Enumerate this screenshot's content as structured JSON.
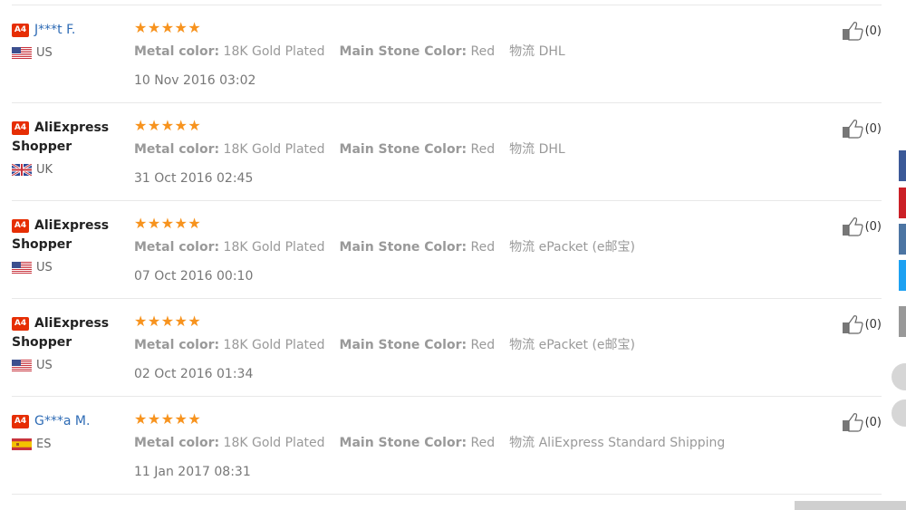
{
  "reviews": [
    {
      "name": "J***t F.",
      "masked": true,
      "badge": "A4",
      "country": "US",
      "flag": "us",
      "rating": "★★★★★",
      "attr1_key": "Metal color:",
      "attr1_val": "18K Gold Plated",
      "attr2_key": "Main Stone Color:",
      "attr2_val": "Red",
      "ship_key": "物流",
      "ship_val": "DHL",
      "date": "10 Nov 2016 03:02",
      "helpful": "(0)"
    },
    {
      "name": "AliExpress Shopper",
      "masked": false,
      "badge": "A4",
      "country": "UK",
      "flag": "uk",
      "rating": "★★★★★",
      "attr1_key": "Metal color:",
      "attr1_val": "18K Gold Plated",
      "attr2_key": "Main Stone Color:",
      "attr2_val": "Red",
      "ship_key": "物流",
      "ship_val": "DHL",
      "date": "31 Oct 2016 02:45",
      "helpful": "(0)"
    },
    {
      "name": "AliExpress Shopper",
      "masked": false,
      "badge": "A4",
      "country": "US",
      "flag": "us",
      "rating": "★★★★★",
      "attr1_key": "Metal color:",
      "attr1_val": "18K Gold Plated",
      "attr2_key": "Main Stone Color:",
      "attr2_val": "Red",
      "ship_key": "物流",
      "ship_val": "ePacket (e邮宝)",
      "date": "07 Oct 2016 00:10",
      "helpful": "(0)"
    },
    {
      "name": "AliExpress Shopper",
      "masked": false,
      "badge": "A4",
      "country": "US",
      "flag": "us",
      "rating": "★★★★★",
      "attr1_key": "Metal color:",
      "attr1_val": "18K Gold Plated",
      "attr2_key": "Main Stone Color:",
      "attr2_val": "Red",
      "ship_key": "物流",
      "ship_val": "ePacket (e邮宝)",
      "date": "02 Oct 2016 01:34",
      "helpful": "(0)"
    },
    {
      "name": "G***a M.",
      "masked": true,
      "badge": "A4",
      "country": "ES",
      "flag": "es",
      "rating": "★★★★★",
      "attr1_key": "Metal color:",
      "attr1_val": "18K Gold Plated",
      "attr2_key": "Main Stone Color:",
      "attr2_val": "Red",
      "ship_key": "物流",
      "ship_val": "AliExpress Standard Shipping",
      "date": "11 Jan 2017 08:31",
      "helpful": "(0)"
    }
  ],
  "colors": {
    "badge": "#e62e04",
    "star": "#f7931e",
    "link": "#2e6bb5",
    "share_facebook": "#3b5998",
    "share_pinterest": "#cb2027",
    "share_vk": "#4c75a3",
    "share_twitter": "#1da1f2",
    "share_email": "#999999"
  }
}
